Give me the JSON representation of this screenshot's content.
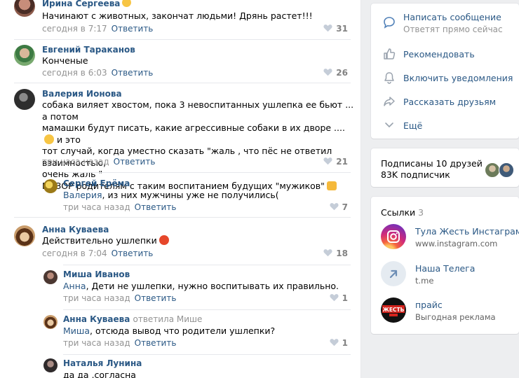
{
  "comments": [
    {
      "author": "Ирина Сергеева",
      "text": "Начинают с животных, закончат людьми! Дрянь растет!!!",
      "time": "сегодня в 7:17",
      "reply": "Ответить",
      "likes": "31"
    },
    {
      "author": "Евгений Тараканов",
      "text": "Конченые",
      "time": "сегодня в 6:03",
      "reply": "Ответить",
      "likes": "26"
    },
    {
      "author": "Валерия Ионова",
      "text_lines": [
        "собака виляет хвостом, пока 3 невоспитанных ушлепка ее бьют ... а потом",
        "мамашки будут писать, какие агрессивные собаки в их дворе ....",
        " и это",
        "тот случай, когда уместно сказать \"жаль , что пёс не ответил взаимностью,",
        "очень жаль \"",
        "ПОЗОР родителям с таким воспитанием будущих \"мужиков\""
      ],
      "time": "три часа назад",
      "reply": "Ответить",
      "likes": "21"
    },
    {
      "author": "Сергей Ерёма",
      "mention": "Валерия",
      "text": ", из них мужчины уже не получились(",
      "time": "три часа назад",
      "reply": "Ответить",
      "likes": "7"
    },
    {
      "author": "Анна Куваева",
      "text": "Действительно ушлепки",
      "time": "сегодня в 7:04",
      "reply": "Ответить",
      "likes": "18"
    },
    {
      "author": "Миша Иванов",
      "mention": "Анна",
      "text": ", Дети не ушлепки, нужно воспитывать их правильно.",
      "time": "три часа назад",
      "reply": "Ответить",
      "likes": "1"
    },
    {
      "author": "Анна Куваева",
      "author_sub": "ответила Мише",
      "mention": "Миша",
      "text": ", отсюда вывод что родители ушлепки?",
      "time": "три часа назад",
      "reply": "Ответить",
      "likes": "1"
    },
    {
      "author": "Наталья Лунина",
      "text": "да да ,согласна"
    }
  ],
  "actions": {
    "message": {
      "label": "Написать сообщение",
      "sub": "Ответят прямо сейчас"
    },
    "recommend": {
      "label": "Рекомендовать"
    },
    "notify": {
      "label": "Включить уведомления"
    },
    "share": {
      "label": "Рассказать друзьям"
    },
    "more": {
      "label": "Ещё"
    }
  },
  "subscribers": {
    "friends": "Подписаны 10 друзей",
    "count": "83K подписчик"
  },
  "links": {
    "title": "Ссылки",
    "count": "3",
    "items": [
      {
        "title": "Тула Жесть Инстаграм",
        "sub": "www.instagram.com",
        "icon": "instagram-icon"
      },
      {
        "title": "Наша Телега",
        "sub": "t.me",
        "icon": "telegram-link-icon"
      },
      {
        "title": "прайс",
        "sub": "Выгодная реклама",
        "icon": "zhest-logo",
        "logo_text": "ЖЕСТЬ"
      }
    ]
  },
  "colors": {
    "link": "#2a5885",
    "muted": "#939393",
    "background": "#edeef0",
    "accent": "#5181b8"
  }
}
